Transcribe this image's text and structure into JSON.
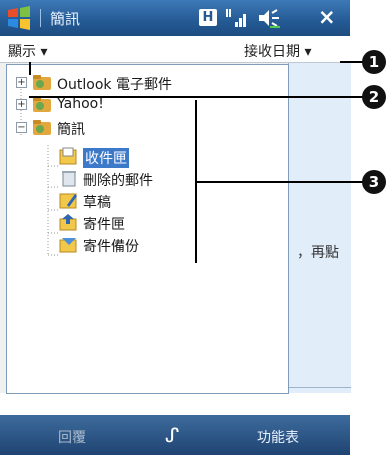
{
  "titlebar": {
    "app_title": "簡訊",
    "h_label": "H"
  },
  "menubar": {
    "view_label": "顯示 ▾",
    "sort_label": "接收日期 ▾"
  },
  "tree": {
    "items": [
      {
        "label": "Outlook 電子郵件",
        "icon": "folder-icon",
        "expand": "+"
      },
      {
        "label": "Yahoo!",
        "icon": "folder-icon",
        "expand": "+"
      },
      {
        "label": "簡訊",
        "icon": "folder-icon",
        "expand": "−"
      },
      {
        "label": "收件匣",
        "icon": "inbox-icon",
        "selected": true
      },
      {
        "label": "刪除的郵件",
        "icon": "trash-icon"
      },
      {
        "label": "草稿",
        "icon": "drafts-icon"
      },
      {
        "label": "寄件匣",
        "icon": "outbox-icon"
      },
      {
        "label": "寄件備份",
        "icon": "sent-items-icon"
      }
    ]
  },
  "preview": {
    "text": "，再點"
  },
  "softkeys": {
    "left": "回覆",
    "right": "功能表"
  },
  "callouts": {
    "one": "1",
    "two": "2",
    "three": "3"
  },
  "colors": {
    "titlebar": "#245a94",
    "selection": "#3d79c9",
    "preview_pane": "#e1edf9"
  }
}
